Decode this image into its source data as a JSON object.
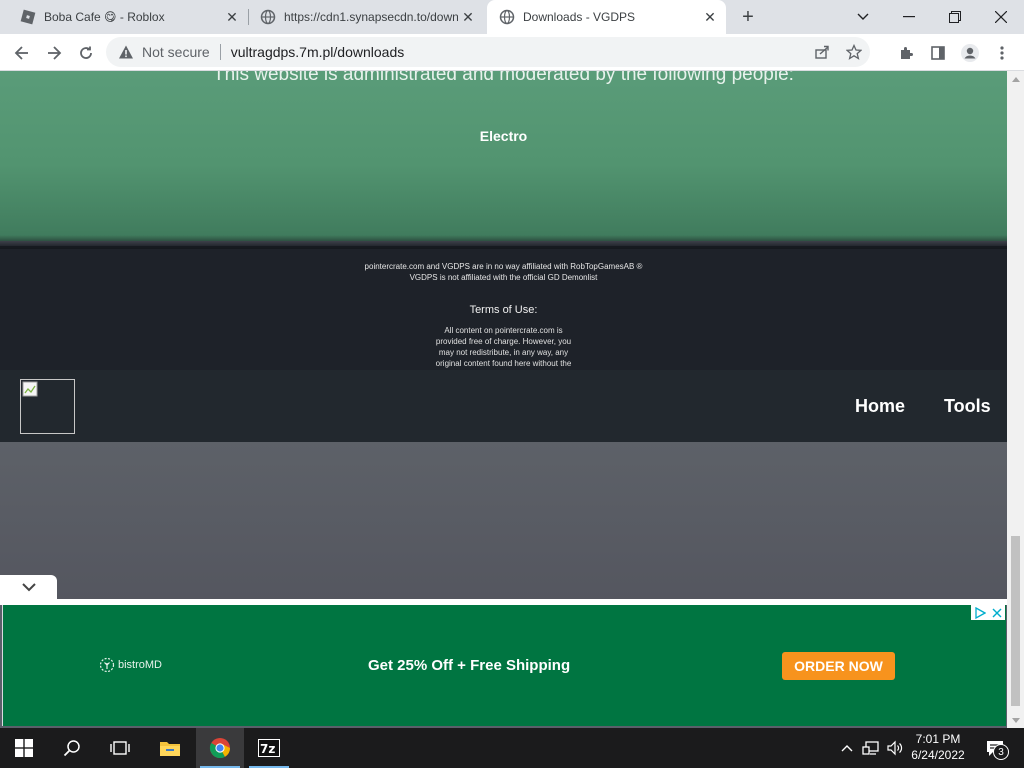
{
  "browser": {
    "tabs": [
      {
        "title": "Boba Cafe 😋 - Roblox",
        "active": false
      },
      {
        "title": "https://cdn1.synapsecdn.to/down",
        "active": false
      },
      {
        "title": "Downloads - VGDPS",
        "active": true
      }
    ],
    "security_label": "Not secure",
    "url": "vultragdps.7m.pl/downloads"
  },
  "page": {
    "admin_heading": "This website is administrated and moderated by the following people:",
    "admin_name": "Electro",
    "disclaimer_line1": "pointercrate.com and VGDPS are in no way affiliated with RobTopGamesAB ®",
    "disclaimer_line2": "VGDPS is not affiliated with the official GD Demonlist",
    "terms_heading": "Terms of Use:",
    "terms_lines": [
      "All content on pointercrate.com is",
      "provided free of charge. However, you",
      "may not redistribute, in any way, any",
      "original content found here without the"
    ],
    "nav": {
      "home": "Home",
      "tools": "Tools"
    }
  },
  "ad": {
    "brand": "bistroMD",
    "headline": "Get 25% Off + Free Shipping",
    "cta": "ORDER NOW",
    "color": "#007541",
    "cta_color": "#f7931d"
  },
  "taskbar": {
    "time": "7:01 PM",
    "date": "6/24/2022",
    "notification_count": "3"
  }
}
